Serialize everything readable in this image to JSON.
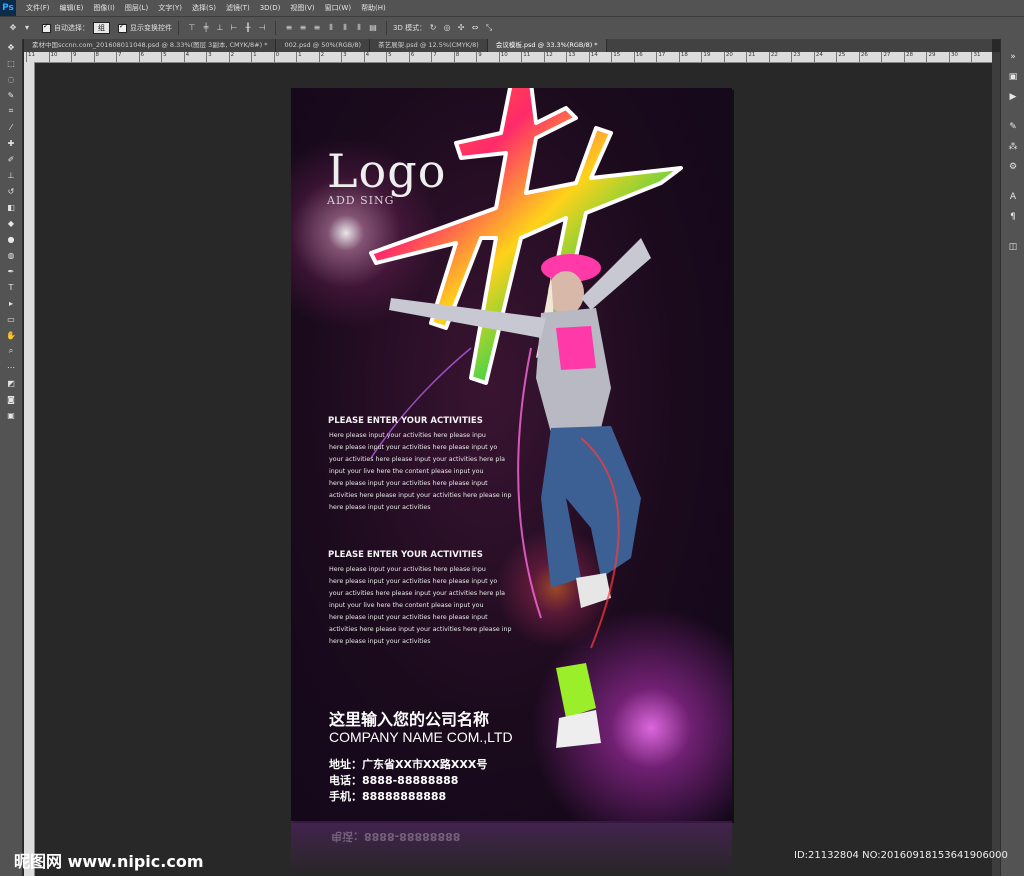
{
  "app": {
    "logo": "Ps"
  },
  "menu": [
    "文件(F)",
    "编辑(E)",
    "图像(I)",
    "图层(L)",
    "文字(Y)",
    "选择(S)",
    "滤镜(T)",
    "3D(D)",
    "视图(V)",
    "窗口(W)",
    "帮助(H)"
  ],
  "options": {
    "auto_select_label": "自动选择：",
    "auto_select_value": "组",
    "show_transform_label": "显示变换控件",
    "mode_label": "3D 模式："
  },
  "tabs": [
    {
      "label": "素材中国sccnn.com_201608011048.psd @ 8.33%(图层 3副本, CMYK/8#) *",
      "active": false
    },
    {
      "label": "002.psd @ 50%(RGB/8)",
      "active": false
    },
    {
      "label": "茶艺展架.psd @ 12.5%(CMYK/8)",
      "active": false
    },
    {
      "label": "会议模板.psd @ 33.3%(RGB/8) *",
      "active": true
    }
  ],
  "ruler_ticks": [
    "11",
    "10",
    "9",
    "8",
    "7",
    "6",
    "5",
    "4",
    "3",
    "2",
    "1",
    "0",
    "1",
    "2",
    "3",
    "4",
    "5",
    "6",
    "7",
    "8",
    "9",
    "10",
    "11",
    "12",
    "13",
    "14",
    "15",
    "16",
    "17",
    "18",
    "19",
    "20",
    "21",
    "22",
    "23",
    "24",
    "25",
    "26",
    "27",
    "28",
    "29",
    "30",
    "31"
  ],
  "poster": {
    "logo": "Logo",
    "logo_sub": "ADD SING",
    "sections": [
      {
        "title": "PLEASE ENTER YOUR ACTIVITIES",
        "lines": [
          "Here please input your activities here please inpu",
          "here please input your activities here please input yo",
          "your activities here please input your activities here pla",
          "input your live here the content please input you",
          "here please input your activities here please input",
          " activities here please input your activities here please inp",
          "here please input your activities"
        ]
      },
      {
        "title": "PLEASE ENTER YOUR ACTIVITIES",
        "lines": [
          "Here please input your activities here please inpu",
          "here please input your activities here please input yo",
          "your activities here please input your activities here pla",
          "input your live here the content please input you",
          "here please input your activities here please input",
          " activities here please input your activities here please inp",
          "here please input your activities"
        ]
      }
    ],
    "company_cn": "这里输入您的公司名称",
    "company_en": "COMPANY NAME COM.,LTD",
    "address": "地址：广东省XX市XX路XXX号",
    "phone": "电话：8888-88888888",
    "mobile": "手机：88888888888",
    "reflection_text": "电话：8888-88888888"
  },
  "watermark": {
    "left": "昵图网 www.nipic.com",
    "right": "ID:21132804 NO:20160918153641906000"
  },
  "colors": {
    "panel": "#535353",
    "workspace": "#282828",
    "poster_purple": "#6b1c86"
  }
}
